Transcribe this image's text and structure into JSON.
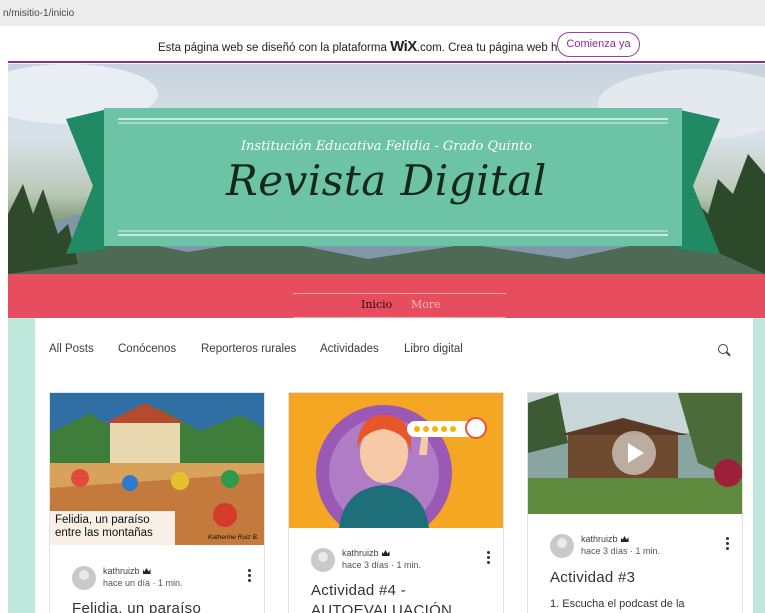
{
  "browser": {
    "url_fragment": "n/misitio-1/inicio"
  },
  "wix_banner": {
    "message_before": "Esta página web se diseñó con la plataforma ",
    "brand": "WiX",
    "message_after": ".com. Crea tu página web hoy.",
    "cta_label": "Comienza ya"
  },
  "hero": {
    "subtitle": "Institución Educativa Felidia - Grado Quinto",
    "title": "Revista Digital"
  },
  "main_nav": {
    "items": [
      "Inicio",
      "More"
    ]
  },
  "blog_nav": {
    "items": [
      "All Posts",
      "Conócenos",
      "Reporteros rurales",
      "Actividades",
      "Libro digital"
    ],
    "search_icon": "search-icon"
  },
  "posts": [
    {
      "image_caption_line1": "Felidia, un paraíso",
      "image_caption_line2": "entre las montañas",
      "image_signature": "Katherine Ruiz B.",
      "author": "kathruizb",
      "time": "hace un día",
      "read": "1 min.",
      "title": "Felidia, un paraíso",
      "excerpt": ""
    },
    {
      "author": "kathruizb",
      "time": "hace 3 días",
      "read": "1 min.",
      "title": "Actividad #4 -",
      "title_line2": "AUTOEVALUACIÓN",
      "excerpt": ""
    },
    {
      "author": "kathruizb",
      "time": "hace 3 días",
      "read": "1 min.",
      "title": "Actividad #3",
      "excerpt": "1. Escucha el podcast de la"
    }
  ],
  "colors": {
    "wix_purple": "#8b2f9a",
    "ribbon_green": "#6cc3a5",
    "ribbon_dark": "#1f8a64",
    "nav_red": "#e64e5f",
    "mint": "#bfe8dc"
  }
}
